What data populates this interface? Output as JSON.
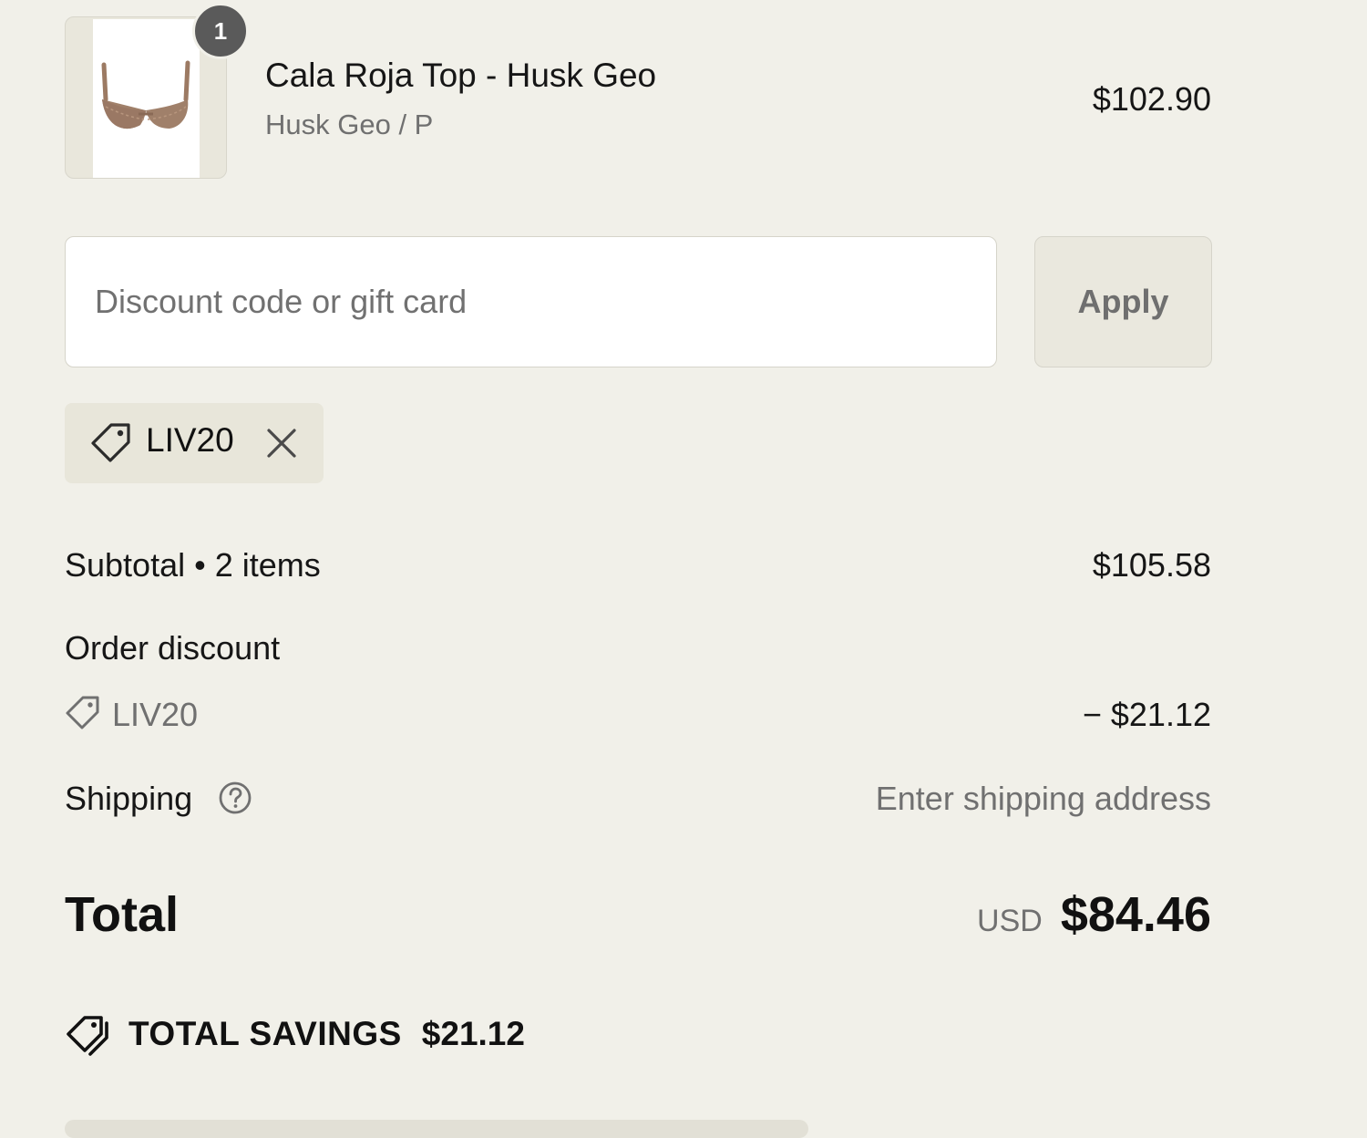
{
  "product": {
    "quantity": "1",
    "title": "Cala Roja Top - Husk Geo",
    "variant": "Husk Geo / P",
    "price": "$102.90",
    "image_icon": "bikini-top-image"
  },
  "discount": {
    "placeholder": "Discount code or gift card",
    "apply_label": "Apply",
    "applied_code": "LIV20"
  },
  "summary": {
    "subtotal_label": "Subtotal • 2 items",
    "subtotal_value": "$105.58",
    "order_discount_label": "Order discount",
    "order_discount_code": "LIV20",
    "order_discount_value": "− $21.12",
    "shipping_label": "Shipping",
    "shipping_value": "Enter shipping address",
    "total_label": "Total",
    "currency": "USD",
    "total_value": "$84.46",
    "savings_label": "TOTAL SAVINGS",
    "savings_value": "$21.12"
  },
  "colors": {
    "background": "#f1f0e9",
    "chip": "#e8e6da",
    "muted_text": "#707070",
    "product_tan": "#a0806a"
  }
}
